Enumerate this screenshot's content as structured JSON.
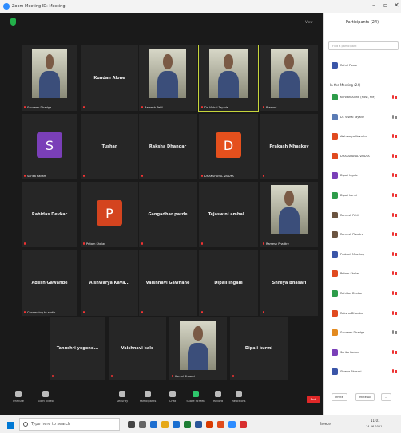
{
  "window": {
    "title": "Zoom Meeting ID: Meeting"
  },
  "meeting": {
    "view_label": "View"
  },
  "tiles": [
    {
      "name": "Sandeep Dhadge",
      "label": "Sandeep Dhadge",
      "type": "video"
    },
    {
      "name": "Kundan Alone",
      "label": "",
      "type": "name"
    },
    {
      "name": "Ramesh Patil",
      "label": "Ramesh Patil",
      "type": "video"
    },
    {
      "name": "Dr. Vishal Tayade",
      "label": "Dr. Vishal Tayade",
      "type": "video"
    },
    {
      "name": "Pramod",
      "label": "Pramod",
      "type": "video"
    },
    {
      "name": "Sarika Kadam",
      "label": "Sarika Kadam",
      "type": "letter",
      "letter": "S",
      "color": "#7a3fb8"
    },
    {
      "name": "Tushar",
      "label": "",
      "type": "name"
    },
    {
      "name": "Raksha Dhandar",
      "label": "",
      "type": "name"
    },
    {
      "name": "DHAKSHAYAL VAIDYA",
      "label": "DHAKSHAYAL VAIDYA",
      "type": "letter",
      "letter": "D",
      "color": "#e5501d"
    },
    {
      "name": "Prakash Mhaskey",
      "label": "",
      "type": "name"
    },
    {
      "name": "Rahidas Devkar",
      "label": "",
      "type": "name"
    },
    {
      "name": "Pritam Shelar",
      "label": "Pritam Shelar",
      "type": "letter",
      "letter": "P",
      "color": "#d4441f"
    },
    {
      "name": "Gangadhar parde",
      "label": "",
      "type": "name"
    },
    {
      "name": "Tejaswini ambal...",
      "label": "",
      "type": "name"
    },
    {
      "name": "Ramesh Phadtre",
      "label": "Ramesh Phadtre",
      "type": "video"
    },
    {
      "name": "Adesh Gawande",
      "label": "Connecting to audio...",
      "type": "name"
    },
    {
      "name": "Aishwarya Kava...",
      "label": "",
      "type": "name"
    },
    {
      "name": "Vaishnavi Gawhane",
      "label": "",
      "type": "name"
    },
    {
      "name": "Dipali Ingale",
      "label": "",
      "type": "name"
    },
    {
      "name": "Shreya Bhasari",
      "label": "",
      "type": "name"
    },
    {
      "name": "Tanushri yogend...",
      "label": "",
      "type": "name"
    },
    {
      "name": "Vaishnavi kale",
      "label": "",
      "type": "name"
    },
    {
      "name": "Komal Bhasari",
      "label": "Komal Bhasari",
      "type": "video"
    },
    {
      "name": "Dipali kurmi",
      "label": "",
      "type": "name"
    }
  ],
  "toolbar": {
    "buttons": [
      {
        "label": "Unmute",
        "icon": "microphone-icon"
      },
      {
        "label": "Start Video",
        "icon": "video-camera-icon"
      },
      {
        "label": "Security",
        "icon": "shield-icon"
      },
      {
        "label": "Participants",
        "icon": "participants-icon"
      },
      {
        "label": "Chat",
        "icon": "chat-icon"
      },
      {
        "label": "Share Screen",
        "icon": "share-screen-icon"
      },
      {
        "label": "Record",
        "icon": "record-icon"
      },
      {
        "label": "Reactions",
        "icon": "reactions-icon"
      }
    ],
    "end_label": "End"
  },
  "participants": {
    "title": "Participants (24)",
    "search_placeholder": "Find a participant",
    "waiting": "Rahul Pawar",
    "in_meeting_header": "In the Meeting (24)",
    "items": [
      {
        "name": "Kundan Alone (Host, me)",
        "color": "#2d9c4a",
        "mic": "red"
      },
      {
        "name": "Dr. Vishal Tayade",
        "color": "#5a7bb5",
        "mic": "grey"
      },
      {
        "name": "Aishwarya Kavathe",
        "color": "#e04a1f",
        "mic": "red"
      },
      {
        "name": "DHAKSHAYAL VAIDYA",
        "color": "#e04a1f",
        "mic": "red"
      },
      {
        "name": "Dipali Ingale",
        "color": "#7a3fb8",
        "mic": "red"
      },
      {
        "name": "Dipali kurmi",
        "color": "#2d9c4a",
        "mic": "red"
      },
      {
        "name": "Ramesh Patil",
        "color": "#6b5440",
        "mic": "red"
      },
      {
        "name": "Ramesh Phadtre",
        "color": "#6b5440",
        "mic": "red"
      },
      {
        "name": "Prakash Mhaskey",
        "color": "#3a55a8",
        "mic": "red"
      },
      {
        "name": "Pritam Shelar",
        "color": "#e04a1f",
        "mic": "red"
      },
      {
        "name": "Rahidas Devkar",
        "color": "#2d9c4a",
        "mic": "red"
      },
      {
        "name": "Raksha Dhandar",
        "color": "#e04a1f",
        "mic": "red"
      },
      {
        "name": "Sandeep Dhadge",
        "color": "#e38a1f",
        "mic": "grey"
      },
      {
        "name": "Sarika Kadam",
        "color": "#7a3fb8",
        "mic": "red"
      },
      {
        "name": "Shreya Bhasari",
        "color": "#3a55a8",
        "mic": "red"
      }
    ],
    "invite_label": "Invite",
    "mute_all_label": "Mute All",
    "more_label": "..."
  },
  "taskbar": {
    "search_text": "Type here to search",
    "tray_text": "Breeze",
    "time": "11:01",
    "date": "14-06-2021"
  }
}
